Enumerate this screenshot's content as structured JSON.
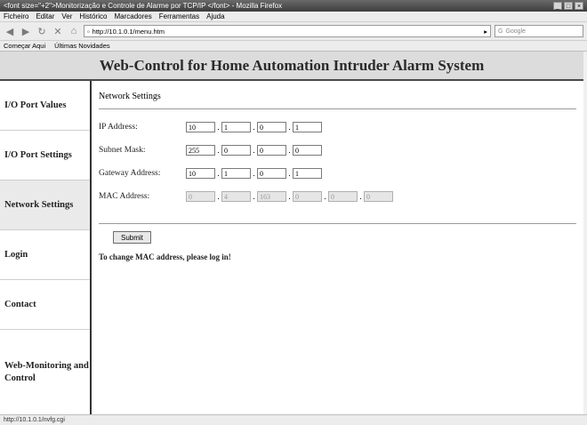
{
  "browser": {
    "title": "<font size=\"+2\">Monitorização e Controle de Alarme por TCP/IP </font> - Mozilla Firefox",
    "menu": [
      "Ficheiro",
      "Editar",
      "Ver",
      "Histórico",
      "Marcadores",
      "Ferramentas",
      "Ajuda"
    ],
    "url": "http://10.1.0.1/menu.htm",
    "search_placeholder": "Google",
    "bookmarks": [
      "Começar Aqui",
      "Últimas Novidades"
    ],
    "status": "http://10.1.0.1/nvfg.cgi"
  },
  "page": {
    "header": "Web-Control for Home Automation Intruder Alarm System",
    "nav": [
      {
        "label": "I/O Port Values"
      },
      {
        "label": "I/O Port Settings"
      },
      {
        "label": "Network Settings",
        "active": true
      },
      {
        "label": "Login"
      },
      {
        "label": "Contact"
      },
      {
        "label": "Web-Monitoring and Control"
      }
    ],
    "section_title": "Network Settings",
    "ip": {
      "label": "IP Address:",
      "values": [
        "10",
        "1",
        "0",
        "1"
      ]
    },
    "subnet": {
      "label": "Subnet Mask:",
      "values": [
        "255",
        "0",
        "0",
        "0"
      ]
    },
    "gateway": {
      "label": "Gateway Address:",
      "values": [
        "10",
        "1",
        "0",
        "1"
      ]
    },
    "mac": {
      "label": "MAC Address:",
      "values": [
        "0",
        "4",
        "163",
        "0",
        "0",
        "0"
      ]
    },
    "submit_label": "Submit",
    "note": "To change MAC address, please log in!"
  }
}
